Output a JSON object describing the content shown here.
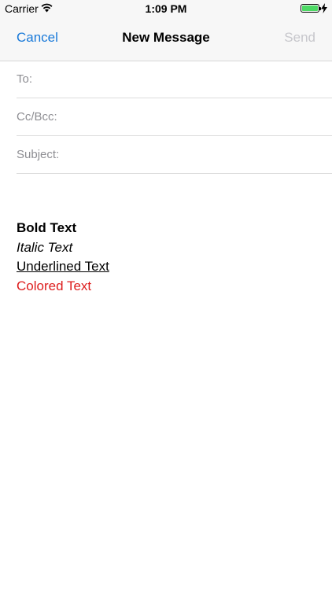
{
  "status_bar": {
    "carrier": "Carrier",
    "time": "1:09 PM",
    "wifi_icon": "wifi-icon",
    "battery_icon": "battery-icon",
    "charging_icon": "bolt-icon",
    "battery_level": 1.0,
    "battery_color": "#4cd964"
  },
  "nav": {
    "cancel_label": "Cancel",
    "title": "New Message",
    "send_label": "Send",
    "accent_color": "#1a7ad9",
    "disabled_color": "#c7c7cc"
  },
  "fields": {
    "to_label": "To:",
    "ccbcc_label": "Cc/Bcc:",
    "subject_label": "Subject:"
  },
  "body": {
    "bold_text": "Bold Text",
    "italic_text": "Italic Text",
    "underlined_text": "Underlined Text",
    "colored_text": "Colored Text",
    "colored_text_color": "#dd1c1c"
  }
}
